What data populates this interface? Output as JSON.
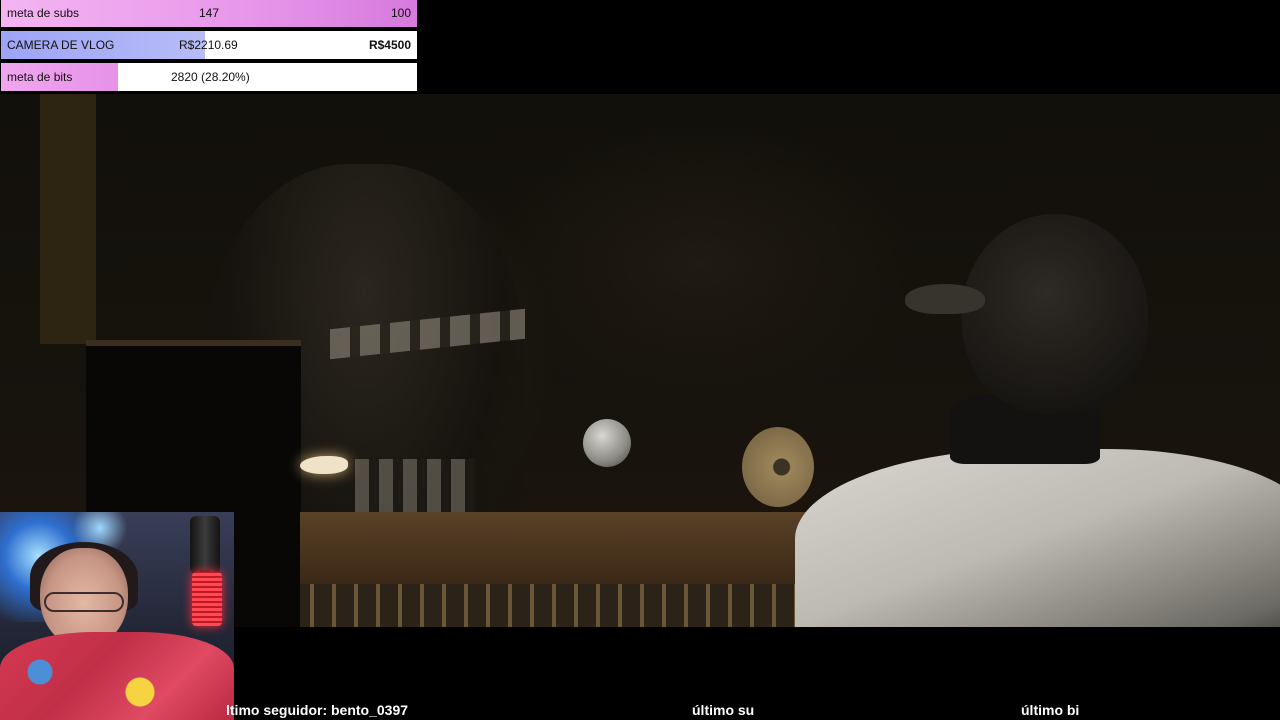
{
  "goals": {
    "subs": {
      "label": "meta de subs",
      "current": "147",
      "target": "100",
      "progress": 1.0
    },
    "camera": {
      "label": "CAMERA DE VLOG",
      "current": "R$2210.69",
      "target": "R$4500",
      "progress": 0.49
    },
    "bits": {
      "label": "meta de bits",
      "current": "2820 (28.20%)",
      "progress": 0.282
    }
  },
  "ticker": {
    "last_follower": "ltimo seguidor: bento_0397",
    "last_sub": "último su",
    "last_bits": "último bi"
  }
}
